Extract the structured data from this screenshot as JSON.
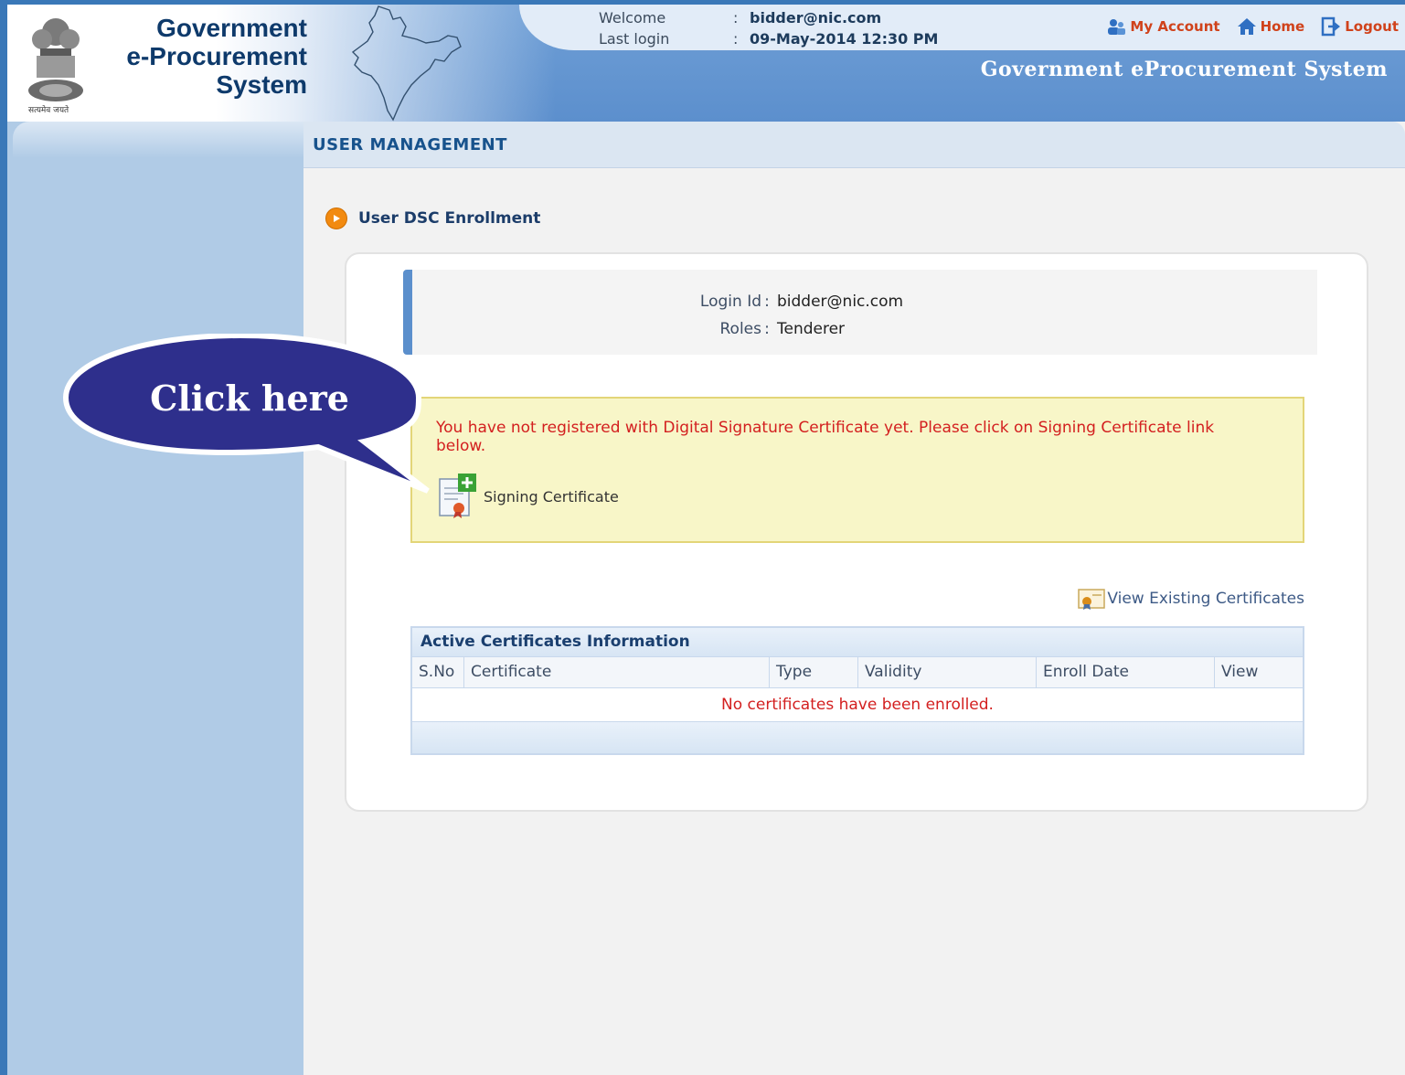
{
  "brand": {
    "line1": "Government",
    "line2": "e-Procurement",
    "line3": "System",
    "emblem_caption": "सत्यमेव जयते"
  },
  "welcome": {
    "welcome_label": "Welcome",
    "welcome_value": "bidder@nic.com",
    "last_login_label": "Last login",
    "last_login_value": "09-May-2014 12:30 PM",
    "separator": ":"
  },
  "topnav": {
    "my_account": "My Account",
    "home": "Home",
    "logout": "Logout"
  },
  "system_title": "Government eProcurement System",
  "content": {
    "header": "USER MANAGEMENT",
    "section_title": "User DSC Enrollment"
  },
  "login_info": {
    "login_id_label": "Login Id",
    "login_id_value": "bidder@nic.com",
    "roles_label": "Roles",
    "roles_value": "Tenderer"
  },
  "warning": {
    "message": "You have not registered with Digital Signature Certificate yet. Please click on Signing Certificate link below.",
    "link_label": "Signing Certificate"
  },
  "view_existing": "View Existing Certificates",
  "table": {
    "title": "Active Certificates Information",
    "columns": [
      "S.No",
      "Certificate",
      "Type",
      "Validity",
      "Enroll Date",
      "View"
    ],
    "empty_message": "No certificates have been enrolled."
  },
  "callout": {
    "text": "Click here"
  },
  "colors": {
    "header_blue": "#5c8fcd",
    "link_red": "#d0421b",
    "warning_red": "#d31f1f",
    "callout_blue": "#2e2f8c"
  }
}
